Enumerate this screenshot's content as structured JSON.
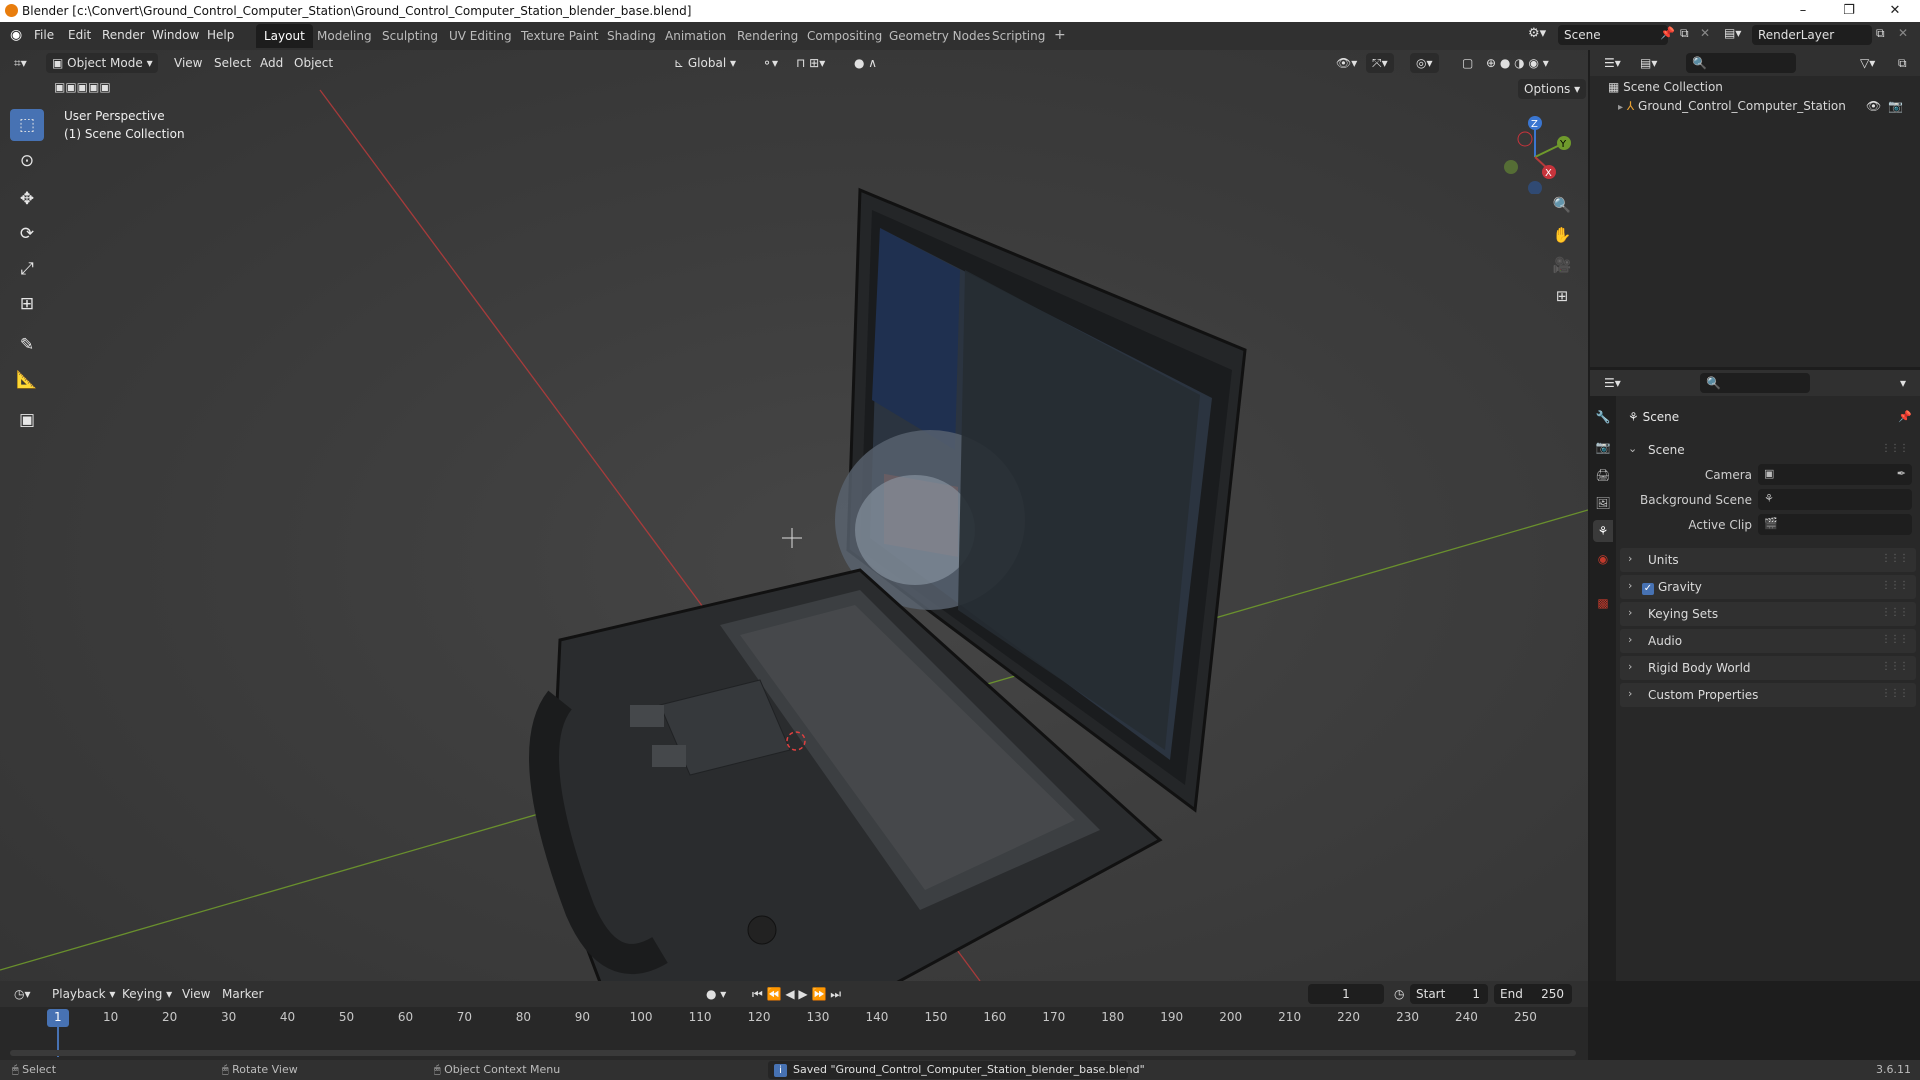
{
  "titlebar": {
    "title": "Blender [c:\\Convert\\Ground_Control_Computer_Station\\Ground_Control_Computer_Station_blender_base.blend]",
    "minimize": "–",
    "maximize": "❐",
    "close": "✕"
  },
  "menubar": {
    "items": [
      "File",
      "Edit",
      "Render",
      "Window",
      "Help"
    ]
  },
  "workspace_tabs": [
    "Layout",
    "Modeling",
    "Sculpting",
    "UV Editing",
    "Texture Paint",
    "Shading",
    "Animation",
    "Rendering",
    "Compositing",
    "Geometry Nodes",
    "Scripting",
    "+"
  ],
  "scene_selector": {
    "value": "Scene"
  },
  "viewlayer_selector": {
    "value": "RenderLayer"
  },
  "viewport": {
    "mode": "Object Mode",
    "menus": [
      "View",
      "Select",
      "Add",
      "Object"
    ],
    "transform_orientation": "Global",
    "options": "Options",
    "overlay_title": "User Perspective",
    "overlay_collection": "(1) Scene Collection",
    "gizmo": {
      "x": "X",
      "y": "Y",
      "z": "Z"
    }
  },
  "outliner": {
    "root": "Scene Collection",
    "item": "Ground_Control_Computer_Station"
  },
  "properties": {
    "context": "Scene",
    "panel_scene": "Scene",
    "rows": [
      {
        "label": "Camera",
        "value": ""
      },
      {
        "label": "Background Scene",
        "value": ""
      },
      {
        "label": "Active Clip",
        "value": ""
      }
    ],
    "panels": [
      "Units",
      "Gravity",
      "Keying Sets",
      "Audio",
      "Rigid Body World",
      "Custom Properties"
    ],
    "gravity_checked": true
  },
  "timeline": {
    "menus": [
      "Playback",
      "Keying",
      "View",
      "Marker"
    ],
    "current_frame": "1",
    "start_label": "Start",
    "start": "1",
    "end_label": "End",
    "end": "250",
    "ticks": [
      "1",
      "10",
      "20",
      "30",
      "40",
      "50",
      "60",
      "70",
      "80",
      "90",
      "100",
      "110",
      "120",
      "130",
      "140",
      "150",
      "160",
      "170",
      "180",
      "190",
      "200",
      "210",
      "220",
      "230",
      "240",
      "250"
    ]
  },
  "statusbar": {
    "select": "Select",
    "rotate": "Rotate View",
    "context_menu": "Object Context Menu",
    "message": "Saved \"Ground_Control_Computer_Station_blender_base.blend\"",
    "version": "3.6.11"
  },
  "colors": {
    "accent": "#4772b3",
    "axis_x": "#b33b3b",
    "axis_y": "#6f9a2c",
    "axis_z": "#3a76d1",
    "bg": "#1d1d1d"
  }
}
